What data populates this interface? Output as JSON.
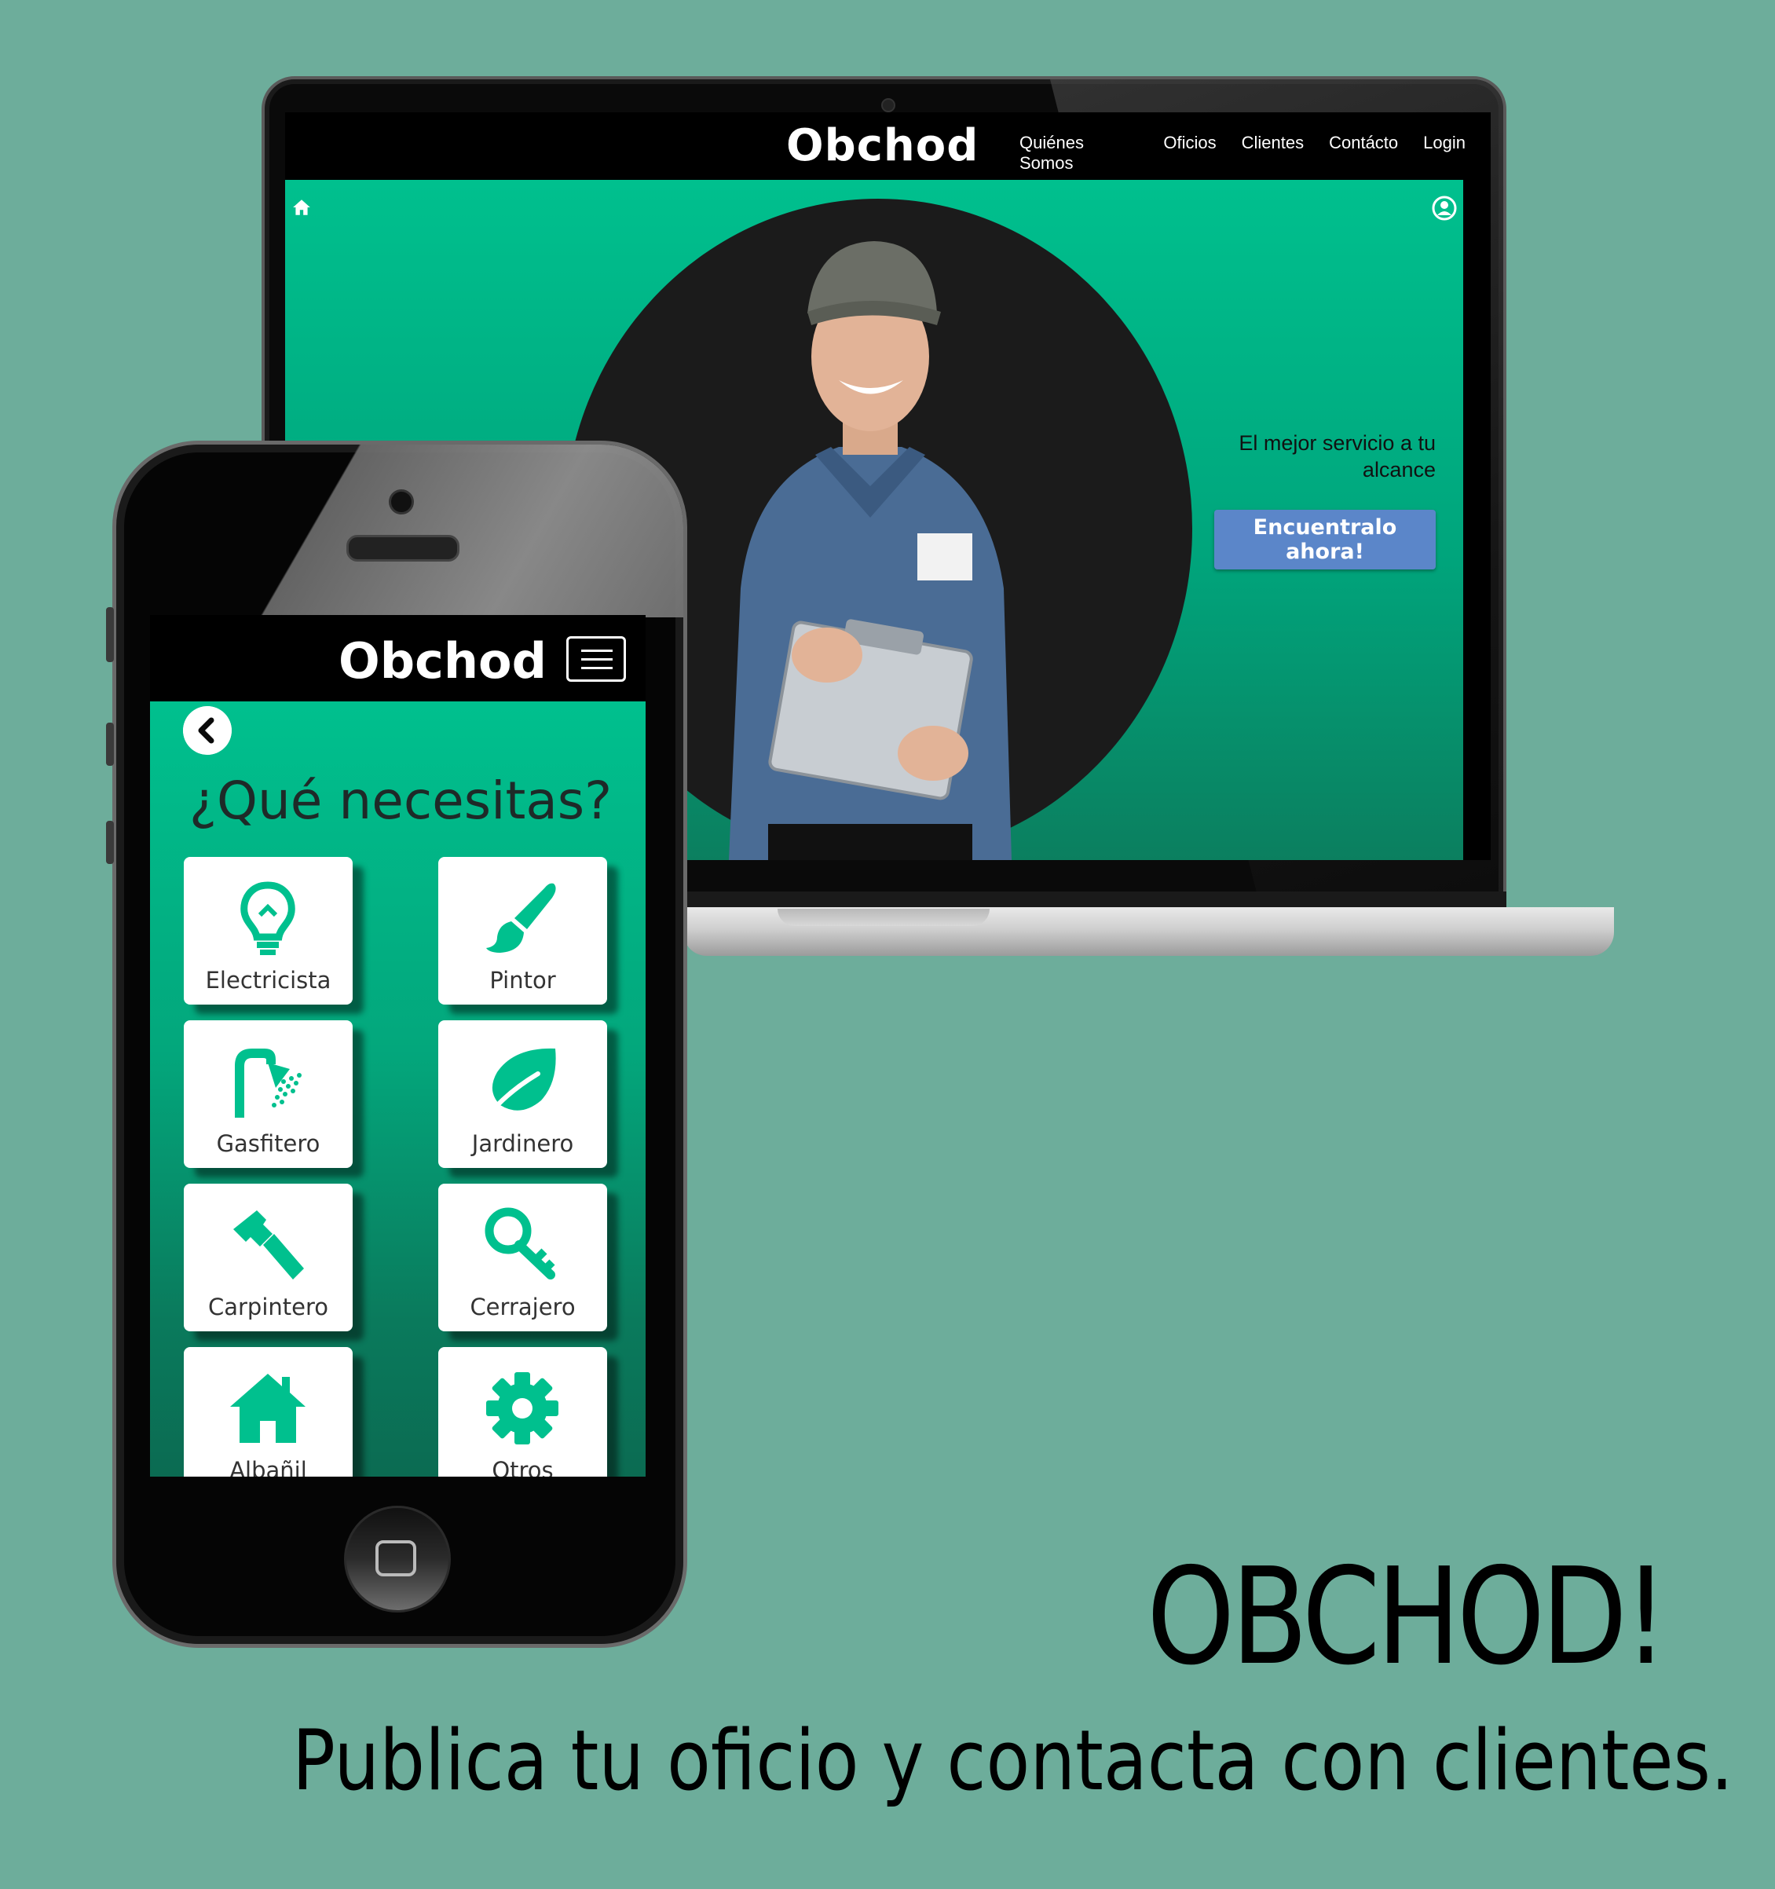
{
  "site": {
    "logo": "Obchod",
    "nav": [
      "Quiénes Somos",
      "Oficios",
      "Clientes",
      "Contácto",
      "Login"
    ],
    "tagline": "El mejor servicio a tu alcance",
    "cta": "Encuentralo ahora!",
    "icons": [
      "home-icon",
      "user-icon"
    ]
  },
  "app": {
    "logo": "Obchod",
    "title": "¿Qué necesitas?",
    "categories": [
      {
        "label": "Electricista",
        "icon": "lightbulb-icon"
      },
      {
        "label": "Pintor",
        "icon": "paintbrush-icon"
      },
      {
        "label": "Gasfitero",
        "icon": "shower-icon"
      },
      {
        "label": "Jardinero",
        "icon": "leaf-icon"
      },
      {
        "label": "Carpintero",
        "icon": "hammer-icon"
      },
      {
        "label": "Cerrajero",
        "icon": "key-icon"
      },
      {
        "label": "Albañil",
        "icon": "house-icon"
      },
      {
        "label": "Otros",
        "icon": "gear-icon"
      }
    ]
  },
  "promo": {
    "brand": "OBCHOD!",
    "slogan": "Publica tu oficio y contacta con clientes."
  },
  "colors": {
    "background": "#6dad9b",
    "accent": "#00c08e",
    "button": "#5b86c9"
  }
}
